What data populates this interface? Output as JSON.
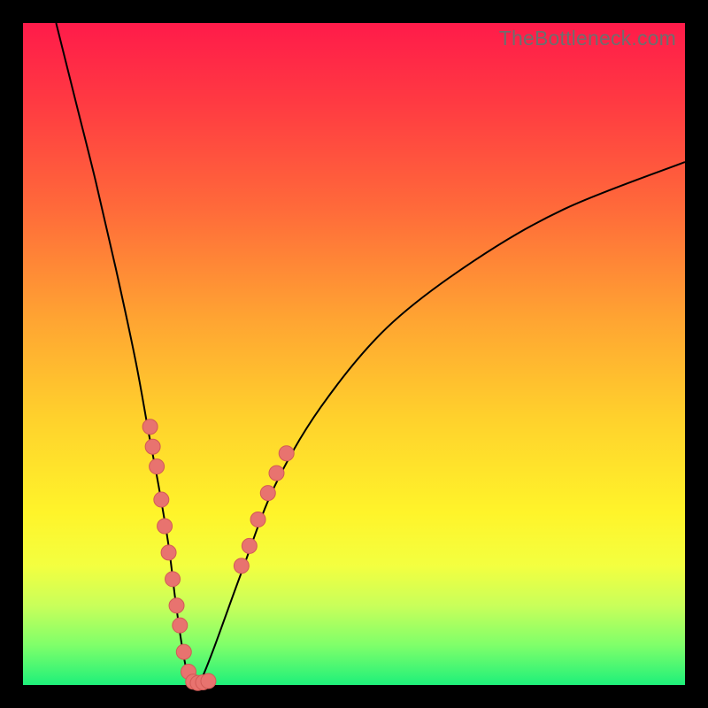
{
  "watermark": "TheBottleneck.com",
  "colors": {
    "frame": "#000000",
    "gradient_top": "#ff1b4a",
    "gradient_bottom": "#1ef07a",
    "curve": "#000000",
    "dot_fill": "#e8736f",
    "dot_stroke": "#d25a56"
  },
  "chart_data": {
    "type": "line",
    "title": "",
    "xlabel": "",
    "ylabel": "",
    "xlim": [
      0,
      100
    ],
    "ylim": [
      0,
      100
    ],
    "grid": false,
    "legend": false,
    "series": [
      {
        "name": "bottleneck-curve",
        "x": [
          5,
          8,
          11,
          14,
          17,
          19,
          20.5,
          22,
          23,
          24,
          25,
          26,
          27,
          29,
          33,
          38,
          45,
          55,
          68,
          82,
          100
        ],
        "y": [
          100,
          88,
          76,
          63,
          49,
          38,
          30,
          21,
          13,
          6,
          1,
          0,
          1,
          6,
          17,
          30,
          42,
          54,
          64,
          72,
          79
        ]
      }
    ],
    "markers": [
      {
        "name": "left-cluster",
        "points": [
          {
            "x": 19.2,
            "y": 39
          },
          {
            "x": 19.6,
            "y": 36
          },
          {
            "x": 20.2,
            "y": 33
          },
          {
            "x": 20.9,
            "y": 28
          },
          {
            "x": 21.4,
            "y": 24
          },
          {
            "x": 22.0,
            "y": 20
          },
          {
            "x": 22.6,
            "y": 16
          },
          {
            "x": 23.2,
            "y": 12
          },
          {
            "x": 23.7,
            "y": 9
          },
          {
            "x": 24.3,
            "y": 5
          },
          {
            "x": 25.0,
            "y": 2
          },
          {
            "x": 25.7,
            "y": 0.5
          },
          {
            "x": 26.4,
            "y": 0.3
          },
          {
            "x": 27.2,
            "y": 0.4
          },
          {
            "x": 28.0,
            "y": 0.6
          }
        ]
      },
      {
        "name": "right-cluster",
        "points": [
          {
            "x": 33.0,
            "y": 18
          },
          {
            "x": 34.2,
            "y": 21
          },
          {
            "x": 35.5,
            "y": 25
          },
          {
            "x": 37.0,
            "y": 29
          },
          {
            "x": 38.3,
            "y": 32
          },
          {
            "x": 39.8,
            "y": 35
          }
        ]
      }
    ]
  }
}
